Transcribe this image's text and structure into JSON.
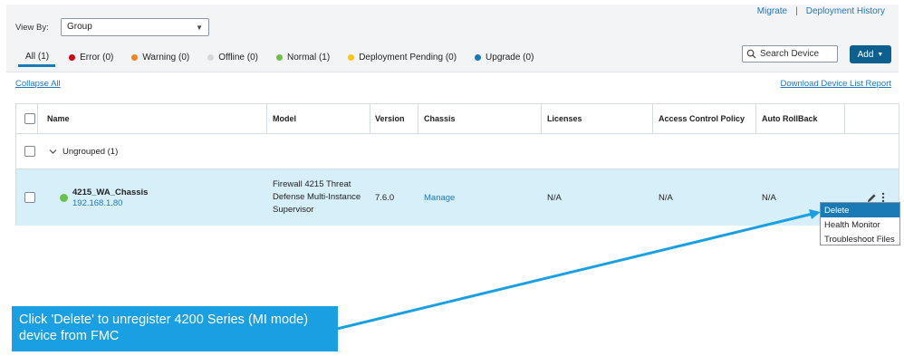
{
  "top_links": {
    "migrate": "Migrate",
    "separator": "|",
    "deployment_history": "Deployment History"
  },
  "view_by": {
    "label": "View By:",
    "value": "Group"
  },
  "filters": [
    {
      "label": "All (1)",
      "color": ""
    },
    {
      "label": "Error (0)",
      "color": "#d0021b"
    },
    {
      "label": "Warning (0)",
      "color": "#f5821f"
    },
    {
      "label": "Offline (0)",
      "color": "#d8d8d8"
    },
    {
      "label": "Normal (1)",
      "color": "#6cc04a"
    },
    {
      "label": "Deployment Pending (0)",
      "color": "#f8c70a"
    },
    {
      "label": "Upgrade (0)",
      "color": "#1a7ab6"
    }
  ],
  "search": {
    "placeholder": "Search Device"
  },
  "add_button": "Add",
  "links": {
    "collapse_all": "Collapse All",
    "download_report": "Download Device List Report"
  },
  "table": {
    "columns": [
      "Name",
      "Model",
      "Version",
      "Chassis",
      "Licenses",
      "Access Control Policy",
      "Auto RollBack"
    ],
    "group": {
      "label": "Ungrouped (1)"
    },
    "device": {
      "name": "4215_WA_Chassis",
      "ip": "192.168.1.80",
      "model_lines": [
        "Firewall 4215 Threat",
        "Defense Multi-Instance",
        "Supervisor"
      ],
      "version": "7.6.0",
      "chassis": "Manage",
      "licenses": "N/A",
      "access_control_policy": "N/A",
      "auto_rollback": "N/A",
      "status_color": "#6cc04a"
    }
  },
  "context_menu": [
    "Delete",
    "Health Monitor",
    "Troubleshoot Files"
  ],
  "callout": "Click 'Delete' to unregister 4200 Series (MI mode) device from FMC",
  "colors": {
    "accent": "#1a7ab6",
    "callout_bg": "#1aa0e2",
    "selected_row": "#d6eff9",
    "link": "#1f78c1"
  }
}
